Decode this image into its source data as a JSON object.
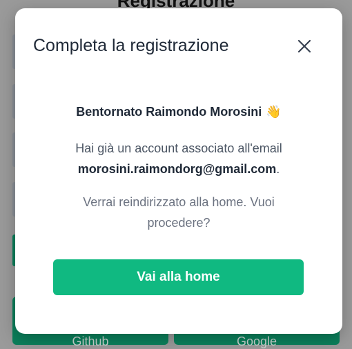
{
  "background": {
    "page_title": "Registrazione",
    "github_label": "Github",
    "google_label": "Google"
  },
  "modal": {
    "title": "Completa la registrazione",
    "close_icon": "close-icon",
    "welcome_text": "Bentornato Raimondo Morosini",
    "welcome_emoji": "👋",
    "info_prefix": "Hai già un account associato all'email",
    "email": "morosini.raimondorg@gmail.com",
    "info_suffix": ".",
    "redirect_text": "Verrai reindirizzato alla home. Vuoi procedere?",
    "home_button": "Vai alla home"
  },
  "colors": {
    "accent": "#10b981",
    "text_dark": "#1f2937",
    "text_muted": "#6b7280",
    "overlay": "#9a9a9a"
  }
}
